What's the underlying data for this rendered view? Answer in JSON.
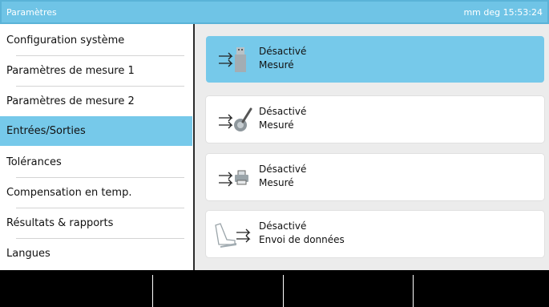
{
  "title_bar": {
    "title": "Paramètres",
    "status": "mm deg 15:53:24"
  },
  "sidebar": {
    "items": [
      {
        "label": "Configuration système"
      },
      {
        "label": "Paramètres de mesure 1"
      },
      {
        "label": "Paramètres de mesure 2"
      },
      {
        "label": "Entrées/Sorties",
        "selected": true
      },
      {
        "label": "Tolérances"
      },
      {
        "label": "Compensation en temp."
      },
      {
        "label": "Résultats & rapports"
      },
      {
        "label": "Langues"
      }
    ]
  },
  "main": {
    "cards": [
      {
        "icon": "usb-export-icon",
        "state": "Désactivé",
        "mode": "Mesuré",
        "selected": true
      },
      {
        "icon": "wireless-probe-export-icon",
        "state": "Désactivé",
        "mode": "Mesuré"
      },
      {
        "icon": "printer-export-icon",
        "state": "Désactivé",
        "mode": "Mesuré"
      },
      {
        "icon": "footswitch-output-icon",
        "state": "Désactivé",
        "mode": "Envoi de données"
      }
    ]
  },
  "colors": {
    "accent": "#76c9ea",
    "title_bar": "#6fc4e6",
    "bottom_bar": "#000000",
    "content_bg": "#ececec"
  }
}
